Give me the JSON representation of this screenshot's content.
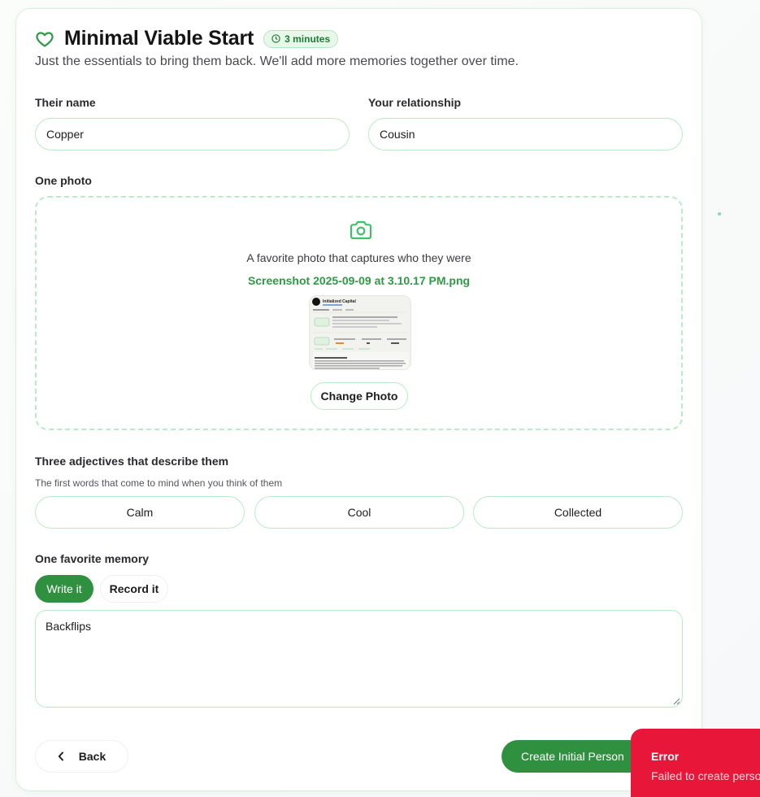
{
  "header": {
    "title": "Minimal Viable Start",
    "badge": "3 minutes",
    "subtitle": "Just the essentials to bring them back. We'll add more memories together over time."
  },
  "fields": {
    "name_label": "Their name",
    "name_value": "Copper",
    "relationship_label": "Your relationship",
    "relationship_value": "Cousin"
  },
  "photo": {
    "label": "One photo",
    "hint": "A favorite photo that captures who they were",
    "file_name": "Screenshot 2025-09-09 at 3.10.17 PM.png",
    "change_label": "Change Photo",
    "thumbnail_title": "Initialized Capital"
  },
  "adjectives": {
    "label": "Three adjectives that describe them",
    "helper": "The first words that come to mind when you think of them",
    "values": [
      "Calm",
      "Cool",
      "Collected"
    ]
  },
  "memory": {
    "label": "One favorite memory",
    "tabs": [
      "Write it",
      "Record it"
    ],
    "active_tab": "Write it",
    "text": "Backflips"
  },
  "footer": {
    "back_label": "Back",
    "create_label": "Create Initial Person"
  },
  "toast": {
    "title": "Error",
    "message": "Failed to create person"
  },
  "colors": {
    "accent": "#2f9140",
    "accent_border": "#b9ecc6",
    "error": "#e8173a"
  }
}
